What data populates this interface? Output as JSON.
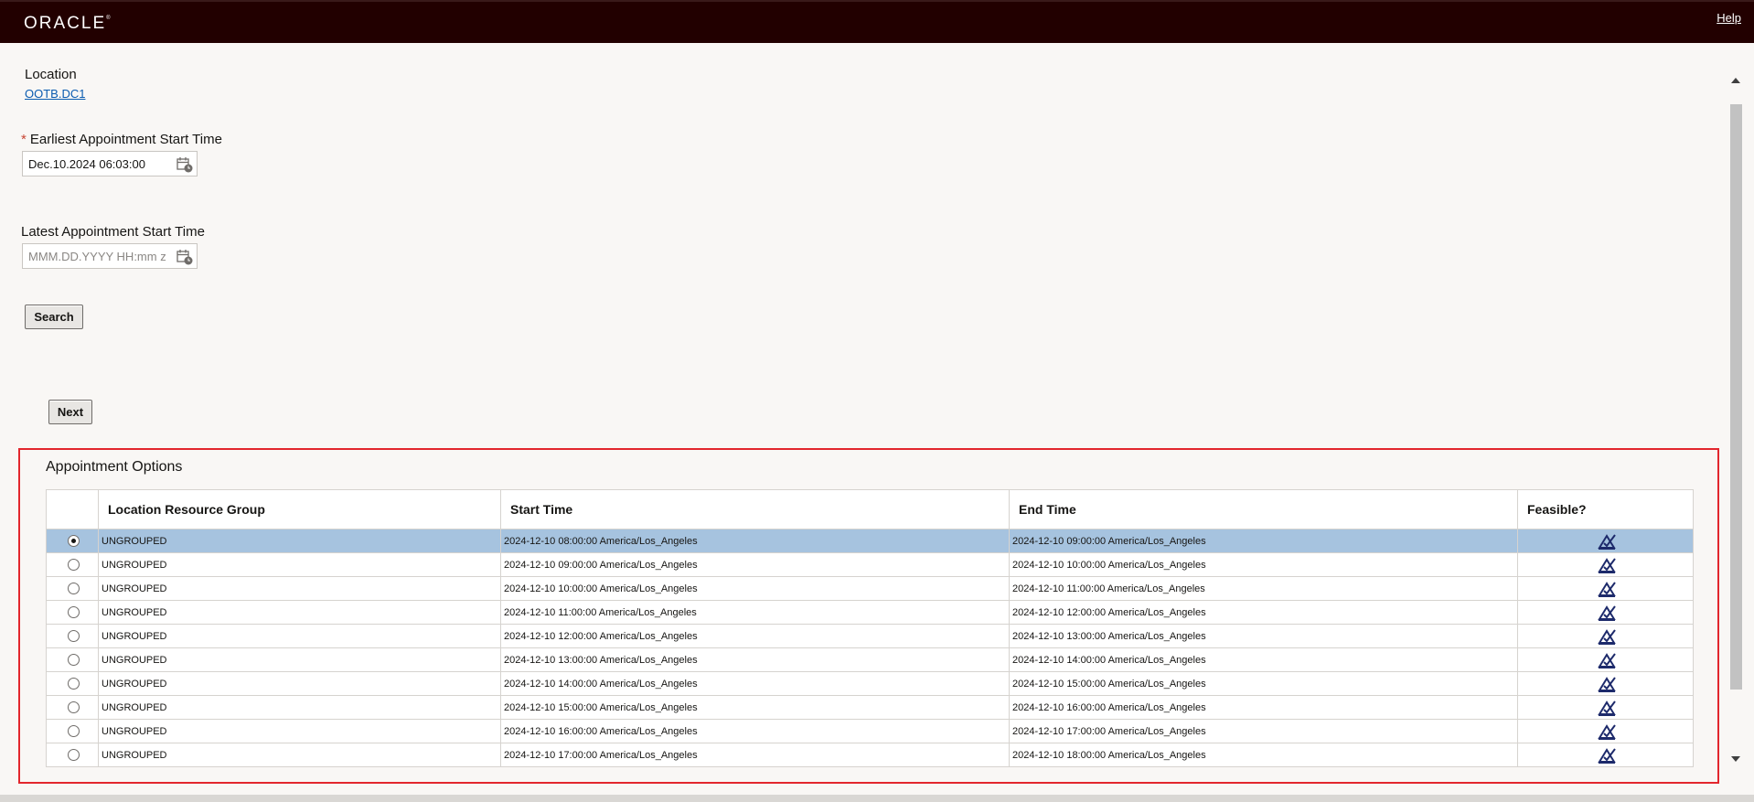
{
  "header": {
    "logo": "ORACLE",
    "logo_mark": "®",
    "help_link": "Help"
  },
  "form": {
    "location_label": "Location",
    "location_value": "OOTB.DC1",
    "required_marker": "*",
    "earliest_label": "Earliest Appointment Start Time",
    "earliest_value": "Dec.10.2024 06:03:00",
    "latest_label": "Latest Appointment Start Time",
    "latest_placeholder": "MMM.DD.YYYY HH:mm z",
    "search_button": "Search",
    "next_button": "Next"
  },
  "appointments": {
    "title": "Appointment Options",
    "columns": [
      "",
      "Location Resource Group",
      "Start Time",
      "End Time",
      "Feasible?"
    ],
    "feasible_icon": "feasible-check-icon",
    "rows": [
      {
        "selected": true,
        "group": "UNGROUPED",
        "start": "2024-12-10 08:00:00 America/Los_Angeles",
        "end": "2024-12-10 09:00:00 America/Los_Angeles"
      },
      {
        "selected": false,
        "group": "UNGROUPED",
        "start": "2024-12-10 09:00:00 America/Los_Angeles",
        "end": "2024-12-10 10:00:00 America/Los_Angeles"
      },
      {
        "selected": false,
        "group": "UNGROUPED",
        "start": "2024-12-10 10:00:00 America/Los_Angeles",
        "end": "2024-12-10 11:00:00 America/Los_Angeles"
      },
      {
        "selected": false,
        "group": "UNGROUPED",
        "start": "2024-12-10 11:00:00 America/Los_Angeles",
        "end": "2024-12-10 12:00:00 America/Los_Angeles"
      },
      {
        "selected": false,
        "group": "UNGROUPED",
        "start": "2024-12-10 12:00:00 America/Los_Angeles",
        "end": "2024-12-10 13:00:00 America/Los_Angeles"
      },
      {
        "selected": false,
        "group": "UNGROUPED",
        "start": "2024-12-10 13:00:00 America/Los_Angeles",
        "end": "2024-12-10 14:00:00 America/Los_Angeles"
      },
      {
        "selected": false,
        "group": "UNGROUPED",
        "start": "2024-12-10 14:00:00 America/Los_Angeles",
        "end": "2024-12-10 15:00:00 America/Los_Angeles"
      },
      {
        "selected": false,
        "group": "UNGROUPED",
        "start": "2024-12-10 15:00:00 America/Los_Angeles",
        "end": "2024-12-10 16:00:00 America/Los_Angeles"
      },
      {
        "selected": false,
        "group": "UNGROUPED",
        "start": "2024-12-10 16:00:00 America/Los_Angeles",
        "end": "2024-12-10 17:00:00 America/Los_Angeles"
      },
      {
        "selected": false,
        "group": "UNGROUPED",
        "start": "2024-12-10 17:00:00 America/Los_Angeles",
        "end": "2024-12-10 18:00:00 America/Los_Angeles"
      }
    ]
  },
  "colors": {
    "header_bg": "#220000",
    "selected_row": "#a6c3df",
    "highlight_border": "#e2262d",
    "link": "#0a5bb0"
  }
}
